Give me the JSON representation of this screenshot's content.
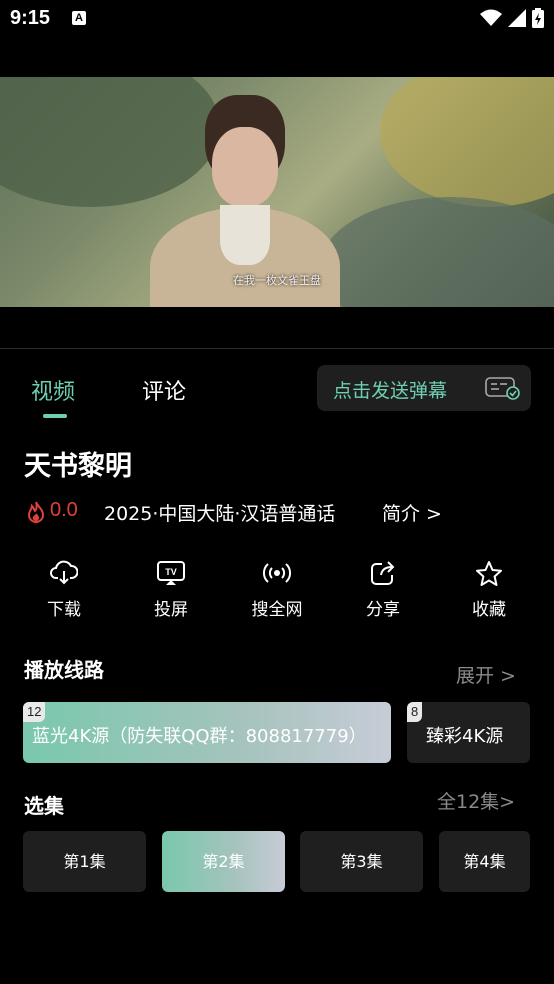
{
  "status": {
    "time": "9:15",
    "notif": "A"
  },
  "video": {
    "subtitle": "在我一枚文雀王盘"
  },
  "tabs": {
    "video": "视频",
    "comment": "评论"
  },
  "danmaku": {
    "label": "点击发送弹幕",
    "icon": "danmaku-settings-icon"
  },
  "show": {
    "title": "天书黎明",
    "score": "0.0",
    "meta": "2025·中国大陆·汉语普通话",
    "intro": "简介 >"
  },
  "actions": [
    {
      "label": "下载",
      "icon": "download-icon"
    },
    {
      "label": "投屏",
      "icon": "tv-cast-icon"
    },
    {
      "label": "搜全网",
      "icon": "broadcast-icon"
    },
    {
      "label": "分享",
      "icon": "share-icon"
    },
    {
      "label": "收藏",
      "icon": "star-icon"
    }
  ],
  "routes": {
    "title": "播放线路",
    "expand": "展开 >",
    "items": [
      {
        "badge": "12",
        "name": "蓝光4K源（防失联QQ群：808817779）"
      },
      {
        "badge": "8",
        "name": "臻彩4K源"
      }
    ]
  },
  "episodes": {
    "title": "选集",
    "all": "全12集>",
    "items": [
      "第1集",
      "第2集",
      "第3集",
      "第4集"
    ]
  },
  "colors": {
    "accent": "#6fcfb2",
    "fire": "#e0403a",
    "card": "#1f1f1f"
  }
}
